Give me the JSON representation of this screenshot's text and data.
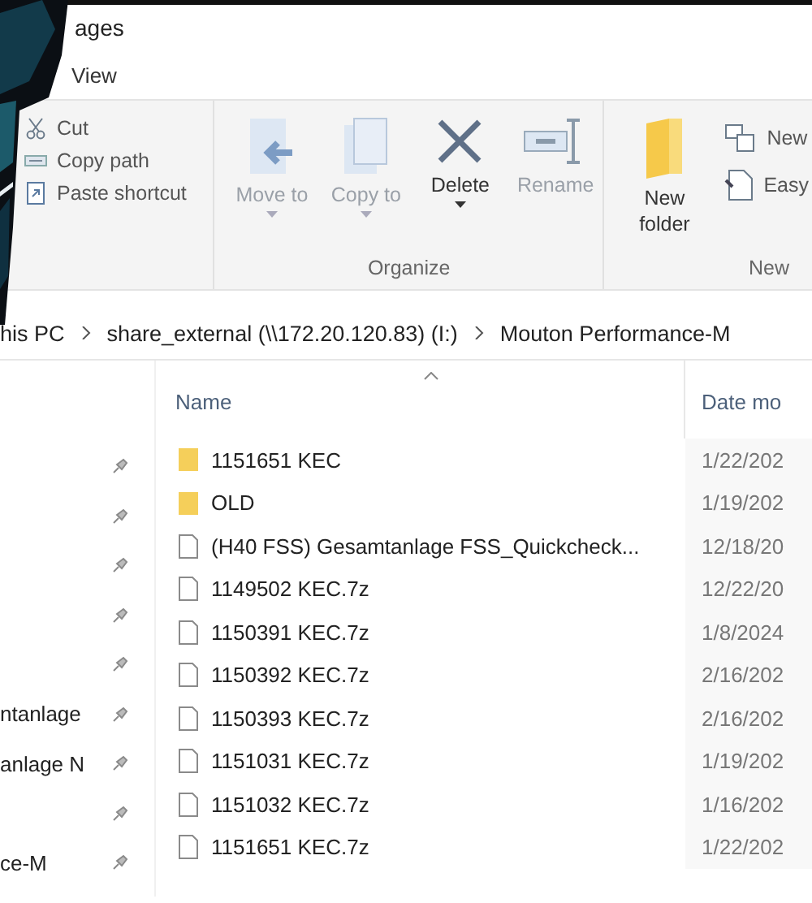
{
  "window": {
    "title": "ages"
  },
  "tabs": [
    {
      "label": "View",
      "selected": false
    }
  ],
  "clipboard": [
    {
      "label": "Cut",
      "kind": "cut"
    },
    {
      "label": "Copy path",
      "kind": "copy-path"
    },
    {
      "label": "Paste shortcut",
      "kind": "paste-shortcut"
    }
  ],
  "organize": {
    "label": "Organize",
    "buttons": [
      {
        "label": "Move to",
        "kind": "move",
        "disabled": true,
        "dropdown": true
      },
      {
        "label": "Copy to",
        "kind": "copy",
        "disabled": true,
        "dropdown": true
      },
      {
        "label": "Delete",
        "kind": "delete",
        "disabled": false,
        "dropdown": true
      },
      {
        "label": "Rename",
        "kind": "rename",
        "disabled": true,
        "dropdown": false
      }
    ]
  },
  "new": {
    "label": "New",
    "folder": {
      "label": "New folder"
    },
    "items": [
      {
        "label": "New",
        "kind": "new-item"
      },
      {
        "label": "Easy",
        "kind": "easy-access"
      }
    ]
  },
  "address": {
    "segments": [
      "his PC",
      "share_external (\\\\172.20.120.83) (I:)",
      "Mouton Performance-M"
    ]
  },
  "sidebar": {
    "items": [
      {
        "pinned": true
      },
      {
        "pinned": true
      },
      {
        "pinned": true
      },
      {
        "pinned": true
      },
      {
        "pinned": true
      },
      {
        "label": "ntanlage",
        "pinned": true
      },
      {
        "label": "anlage N",
        "pinned": true
      },
      {
        "pinned": true
      },
      {
        "label": "ce-M",
        "pinned": true
      }
    ]
  },
  "table": {
    "columns": [
      {
        "label": "Name",
        "sorted": true
      },
      {
        "label": "Date mo"
      }
    ],
    "rows": [
      {
        "name": "1151651 KEC",
        "date": "1/22/202",
        "kind": "folder"
      },
      {
        "name": "OLD",
        "date": "1/19/202",
        "kind": "folder"
      },
      {
        "name": "(H40 FSS) Gesamtanlage FSS_Quickcheck...",
        "date": "12/18/20",
        "kind": "file"
      },
      {
        "name": "1149502 KEC.7z",
        "date": "12/22/20",
        "kind": "file"
      },
      {
        "name": "1150391 KEC.7z",
        "date": "1/8/2024",
        "kind": "file"
      },
      {
        "name": "1150392 KEC.7z",
        "date": "2/16/202",
        "kind": "file"
      },
      {
        "name": "1150393 KEC.7z",
        "date": "2/16/202",
        "kind": "file"
      },
      {
        "name": "1151031 KEC.7z",
        "date": "1/19/202",
        "kind": "file"
      },
      {
        "name": "1151032 KEC.7z",
        "date": "1/16/202",
        "kind": "file"
      },
      {
        "name": "1151651 KEC.7z",
        "date": "1/22/202",
        "kind": "file"
      }
    ]
  }
}
